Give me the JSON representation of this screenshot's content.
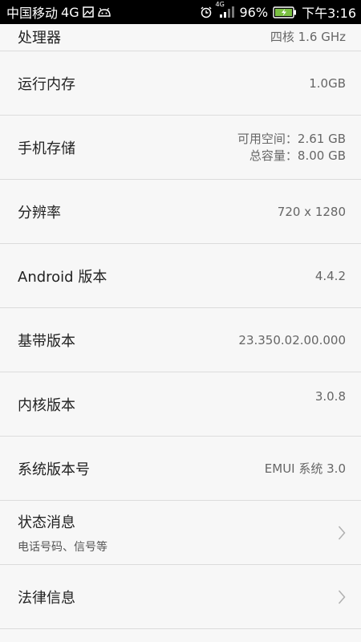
{
  "status_bar": {
    "carrier": "中国移动",
    "network_type": "4G",
    "signal_type": "4G",
    "battery": "96%",
    "time": "下午3:16",
    "icons": [
      "image-icon",
      "android-icon",
      "alarm-icon",
      "signal-icon",
      "battery-charging-icon"
    ]
  },
  "rows": [
    {
      "label": "处理器",
      "value": "四核 1.6 GHz"
    },
    {
      "label": "运行内存",
      "value": "1.0GB"
    },
    {
      "label": "手机存储",
      "value_line1": "可用空间：2.61 GB",
      "value_line2": "总容量：8.00 GB"
    },
    {
      "label": "分辨率",
      "value": "720 x 1280"
    },
    {
      "label": "Android 版本",
      "value": "4.4.2"
    },
    {
      "label": "基带版本",
      "value": "23.350.02.00.000"
    },
    {
      "label": "内核版本",
      "value": "3.0.8"
    },
    {
      "label": "系统版本号",
      "value": "EMUI 系统 3.0"
    },
    {
      "label": "状态消息",
      "sub": "电话号码、信号等"
    },
    {
      "label": "法律信息"
    }
  ]
}
